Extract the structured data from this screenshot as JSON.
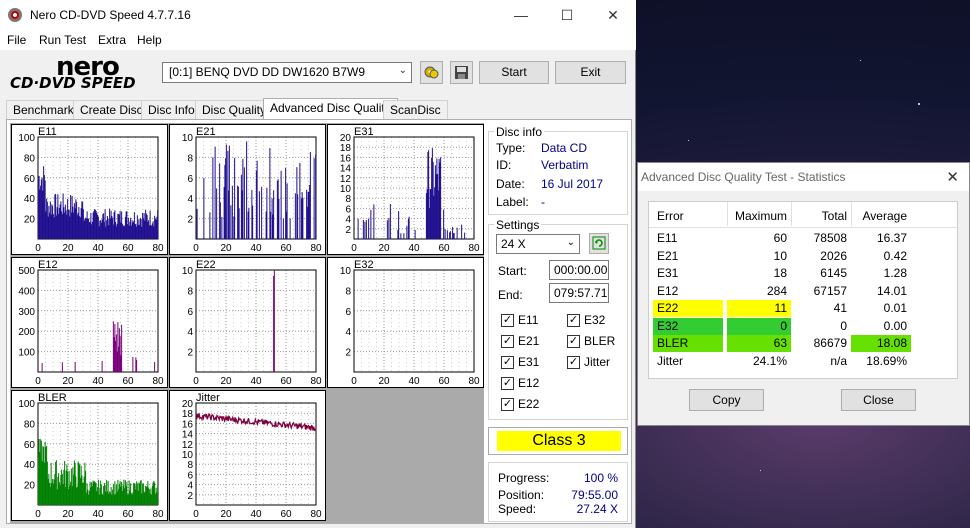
{
  "window": {
    "title": "Nero CD-DVD Speed 4.7.7.16",
    "minimize": "—",
    "maximize": "☐",
    "close": "✕"
  },
  "menu": [
    "File",
    "Run Test",
    "Extra",
    "Help"
  ],
  "logo": {
    "line1": "nero",
    "line2": "CD·DVD SPEED"
  },
  "toolbar": {
    "drive": "[0:1]   BENQ DVD DD DW1620 B7W9",
    "start_label": "Start",
    "exit_label": "Exit"
  },
  "tabs": [
    "Benchmark",
    "Create Disc",
    "Disc Info",
    "Disc Quality",
    "Advanced Disc Quality",
    "ScanDisc"
  ],
  "active_tab": "Advanced Disc Quality",
  "chart_data": [
    {
      "type": "bar",
      "name": "E11",
      "ymax": 100,
      "yticks": [
        20,
        40,
        60,
        80,
        100
      ],
      "xticks": [
        0,
        20,
        40,
        60,
        80
      ],
      "color": "#1f0f8f",
      "profile": "e11"
    },
    {
      "type": "bar",
      "name": "E21",
      "ymax": 10,
      "yticks": [
        2,
        4,
        6,
        8,
        10
      ],
      "xticks": [
        0,
        20,
        40,
        60,
        80
      ],
      "color": "#1f0f8f",
      "profile": "e21"
    },
    {
      "type": "bar",
      "name": "E31",
      "ymax": 20,
      "yticks": [
        2,
        4,
        6,
        8,
        10,
        12,
        14,
        16,
        18,
        20
      ],
      "xticks": [
        0,
        20,
        40,
        60,
        80
      ],
      "color": "#1f0f8f",
      "profile": "e31"
    },
    {
      "type": "bar",
      "name": "E12",
      "ymax": 500,
      "yticks": [
        100,
        200,
        300,
        400,
        500
      ],
      "xticks": [
        0,
        20,
        40,
        60,
        80
      ],
      "color": "#7a007a",
      "profile": "e12"
    },
    {
      "type": "bar",
      "name": "E22",
      "ymax": 10,
      "yticks": [
        2,
        4,
        6,
        8,
        10
      ],
      "xticks": [
        0,
        20,
        40,
        60,
        80
      ],
      "color": "#7a007a",
      "profile": "e22"
    },
    {
      "type": "bar",
      "name": "E32",
      "ymax": 10,
      "yticks": [
        2,
        4,
        6,
        8,
        10
      ],
      "xticks": [
        0,
        20,
        40,
        60,
        80
      ],
      "color": "#7a007a",
      "profile": "none"
    },
    {
      "type": "bar",
      "name": "BLER",
      "ymax": 100,
      "yticks": [
        20,
        40,
        60,
        80,
        100
      ],
      "xticks": [
        0,
        20,
        40,
        60,
        80
      ],
      "color": "#008000",
      "profile": "bler"
    },
    {
      "type": "line",
      "name": "Jitter",
      "ymax": 20,
      "yticks": [
        2,
        4,
        6,
        8,
        10,
        12,
        14,
        16,
        18,
        20
      ],
      "xticks": [
        0,
        20,
        40,
        60,
        80
      ],
      "color": "#800040",
      "profile": "jitter"
    }
  ],
  "disc_info": {
    "title": "Disc info",
    "type_label": "Type:",
    "type": "Data CD",
    "id_label": "ID:",
    "id": "Verbatim",
    "date_label": "Date:",
    "date": "16 Jul 2017",
    "label_label": "Label:",
    "label": "-"
  },
  "settings": {
    "title": "Settings",
    "speed": "24 X",
    "start_label": "Start:",
    "start": "000:00.00",
    "end_label": "End:",
    "end": "079:57.71",
    "checks": [
      {
        "label": "E11",
        "checked": true
      },
      {
        "label": "E32",
        "checked": true
      },
      {
        "label": "E21",
        "checked": true
      },
      {
        "label": "BLER",
        "checked": true
      },
      {
        "label": "E31",
        "checked": true
      },
      {
        "label": "Jitter",
        "checked": true
      },
      {
        "label": "E12",
        "checked": true
      },
      {
        "label": "E22",
        "checked": true
      }
    ]
  },
  "class_label": "Class 3",
  "progress": {
    "progress_label": "Progress:",
    "progress": "100 %",
    "position_label": "Position:",
    "position": "79:55.00",
    "speed_label": "Speed:",
    "speed": "27.24 X"
  },
  "stats_dialog": {
    "title": "Advanced Disc Quality Test - Statistics",
    "headers": [
      "Error",
      "Maximum",
      "Total",
      "Average"
    ],
    "rows": [
      {
        "error": "E11",
        "max": "60",
        "total": "78508",
        "avg": "16.37",
        "max_color": "",
        "err_color": "",
        "avg_color": ""
      },
      {
        "error": "E21",
        "max": "10",
        "total": "2026",
        "avg": "0.42",
        "max_color": "",
        "err_color": "",
        "avg_color": ""
      },
      {
        "error": "E31",
        "max": "18",
        "total": "6145",
        "avg": "1.28",
        "max_color": "",
        "err_color": "",
        "avg_color": ""
      },
      {
        "error": "E12",
        "max": "284",
        "total": "67157",
        "avg": "14.01",
        "max_color": "",
        "err_color": "",
        "avg_color": ""
      },
      {
        "error": "E22",
        "max": "11",
        "total": "41",
        "avg": "0.01",
        "max_color": "#ffff00",
        "err_color": "#ffff00",
        "avg_color": ""
      },
      {
        "error": "E32",
        "max": "0",
        "total": "0",
        "avg": "0.00",
        "max_color": "#33cc33",
        "err_color": "#33cc33",
        "avg_color": ""
      },
      {
        "error": "BLER",
        "max": "63",
        "total": "86679",
        "avg": "18.08",
        "max_color": "#66e000",
        "err_color": "#66e000",
        "avg_color": "#66e000"
      },
      {
        "error": "Jitter",
        "max": "24.1%",
        "total": "n/a",
        "avg": "18.69%",
        "max_color": "",
        "err_color": "",
        "avg_color": ""
      }
    ],
    "copy_label": "Copy",
    "close_label": "Close"
  }
}
